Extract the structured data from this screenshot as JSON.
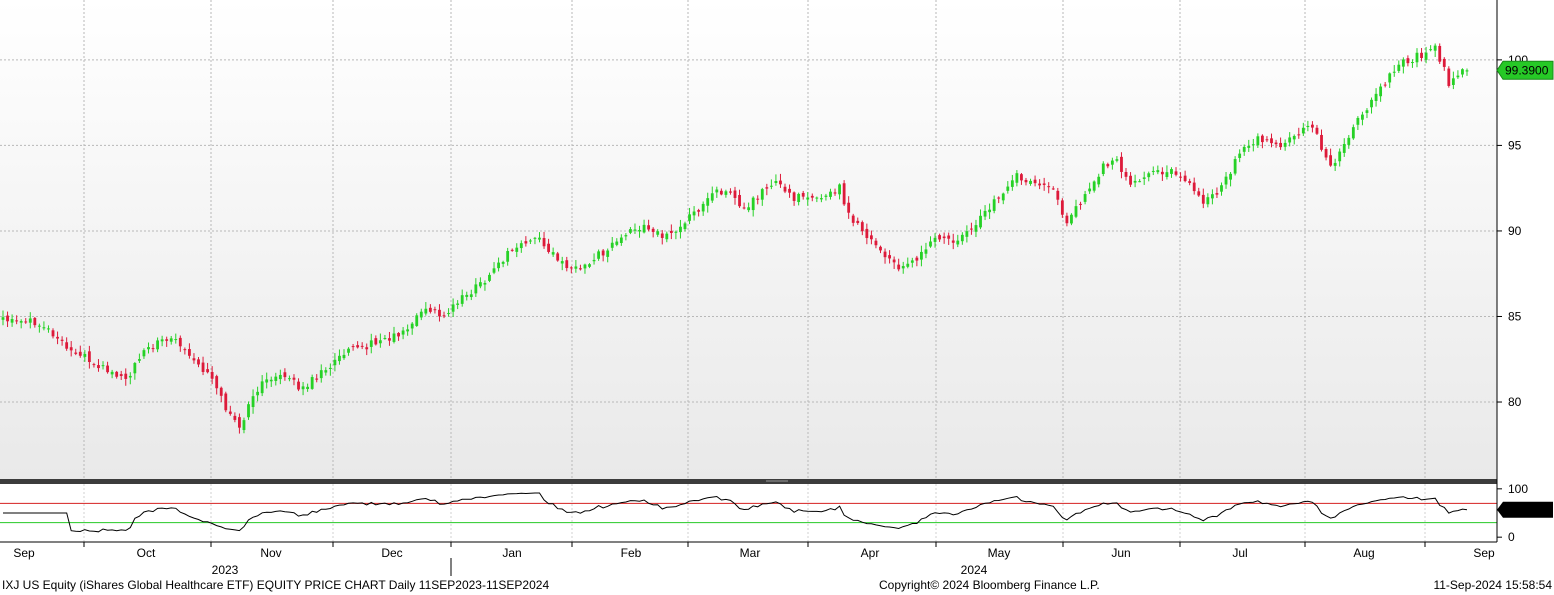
{
  "chart_data": {
    "type": "candlestick",
    "ticker_label": "IXJ US Equity (iShares Global Healthcare ETF) EQUITY PRICE CHART  Daily 11SEP2023-11SEP2024",
    "copyright": "Copyright© 2024 Bloomberg Finance L.P.",
    "timestamp": "11-Sep-2024 15:58:54",
    "x_month_labels": [
      "Sep",
      "Oct",
      "Nov",
      "Dec",
      "Jan",
      "Feb",
      "Mar",
      "Apr",
      "May",
      "Jun",
      "Jul",
      "Aug",
      "Sep"
    ],
    "x_year_labels": [
      "2023",
      "2024"
    ],
    "price_axis": {
      "ticks": [
        "80",
        "85",
        "90",
        "95",
        "100"
      ],
      "ylim": [
        75.5,
        103.5
      ],
      "last_value": "99.3900"
    },
    "rsi_axis": {
      "ticks": [
        "0",
        "100"
      ],
      "ylim": [
        -10,
        110
      ],
      "upper_band": 70,
      "lower_band": 30,
      "last_value": "56.7486"
    },
    "colors": {
      "up": "#26d126",
      "down": "#dd1a3a",
      "last_price_tag": "#26c926",
      "upper_band": "#d42020",
      "lower_band": "#26c926"
    },
    "grid": true,
    "close_keypoints": [
      [
        0,
        85.0
      ],
      [
        8,
        84.7
      ],
      [
        15,
        83.0
      ],
      [
        22,
        82.0
      ],
      [
        27,
        81.3
      ],
      [
        32,
        83.2
      ],
      [
        38,
        83.8
      ],
      [
        42,
        82.5
      ],
      [
        46,
        81.3
      ],
      [
        50,
        79.2
      ],
      [
        52,
        78.6
      ],
      [
        56,
        80.8
      ],
      [
        60,
        81.7
      ],
      [
        63,
        81.2
      ],
      [
        66,
        80.8
      ],
      [
        70,
        81.8
      ],
      [
        76,
        82.9
      ],
      [
        82,
        83.5
      ],
      [
        88,
        84.0
      ],
      [
        93,
        85.6
      ],
      [
        97,
        85.0
      ],
      [
        100,
        85.8
      ],
      [
        106,
        87.2
      ],
      [
        112,
        89.0
      ],
      [
        118,
        89.6
      ],
      [
        122,
        88.2
      ],
      [
        127,
        87.8
      ],
      [
        132,
        88.8
      ],
      [
        137,
        89.8
      ],
      [
        142,
        90.3
      ],
      [
        146,
        89.6
      ],
      [
        152,
        91.0
      ],
      [
        157,
        92.5
      ],
      [
        160,
        92.0
      ],
      [
        163,
        91.2
      ],
      [
        167,
        92.3
      ],
      [
        170,
        92.8
      ],
      [
        174,
        92.0
      ],
      [
        178,
        91.8
      ],
      [
        184,
        92.5
      ],
      [
        186,
        91.0
      ],
      [
        190,
        89.8
      ],
      [
        194,
        88.6
      ],
      [
        198,
        87.7
      ],
      [
        201,
        88.4
      ],
      [
        205,
        89.6
      ],
      [
        210,
        89.3
      ],
      [
        214,
        90.5
      ],
      [
        219,
        92.0
      ],
      [
        223,
        93.2
      ],
      [
        226,
        93.0
      ],
      [
        230,
        92.8
      ],
      [
        234,
        90.6
      ],
      [
        238,
        92.0
      ],
      [
        242,
        93.8
      ],
      [
        245,
        94.0
      ],
      [
        248,
        92.8
      ],
      [
        253,
        93.4
      ],
      [
        257,
        93.6
      ],
      [
        261,
        92.8
      ],
      [
        264,
        91.7
      ],
      [
        268,
        92.6
      ],
      [
        272,
        94.5
      ],
      [
        276,
        95.3
      ],
      [
        280,
        95.0
      ],
      [
        284,
        95.5
      ],
      [
        288,
        96.1
      ],
      [
        292,
        93.6
      ],
      [
        296,
        95.6
      ],
      [
        300,
        97.2
      ],
      [
        304,
        98.7
      ],
      [
        308,
        99.8
      ],
      [
        312,
        100.3
      ],
      [
        315,
        100.8
      ],
      [
        318,
        98.7
      ],
      [
        322,
        99.39
      ]
    ]
  }
}
